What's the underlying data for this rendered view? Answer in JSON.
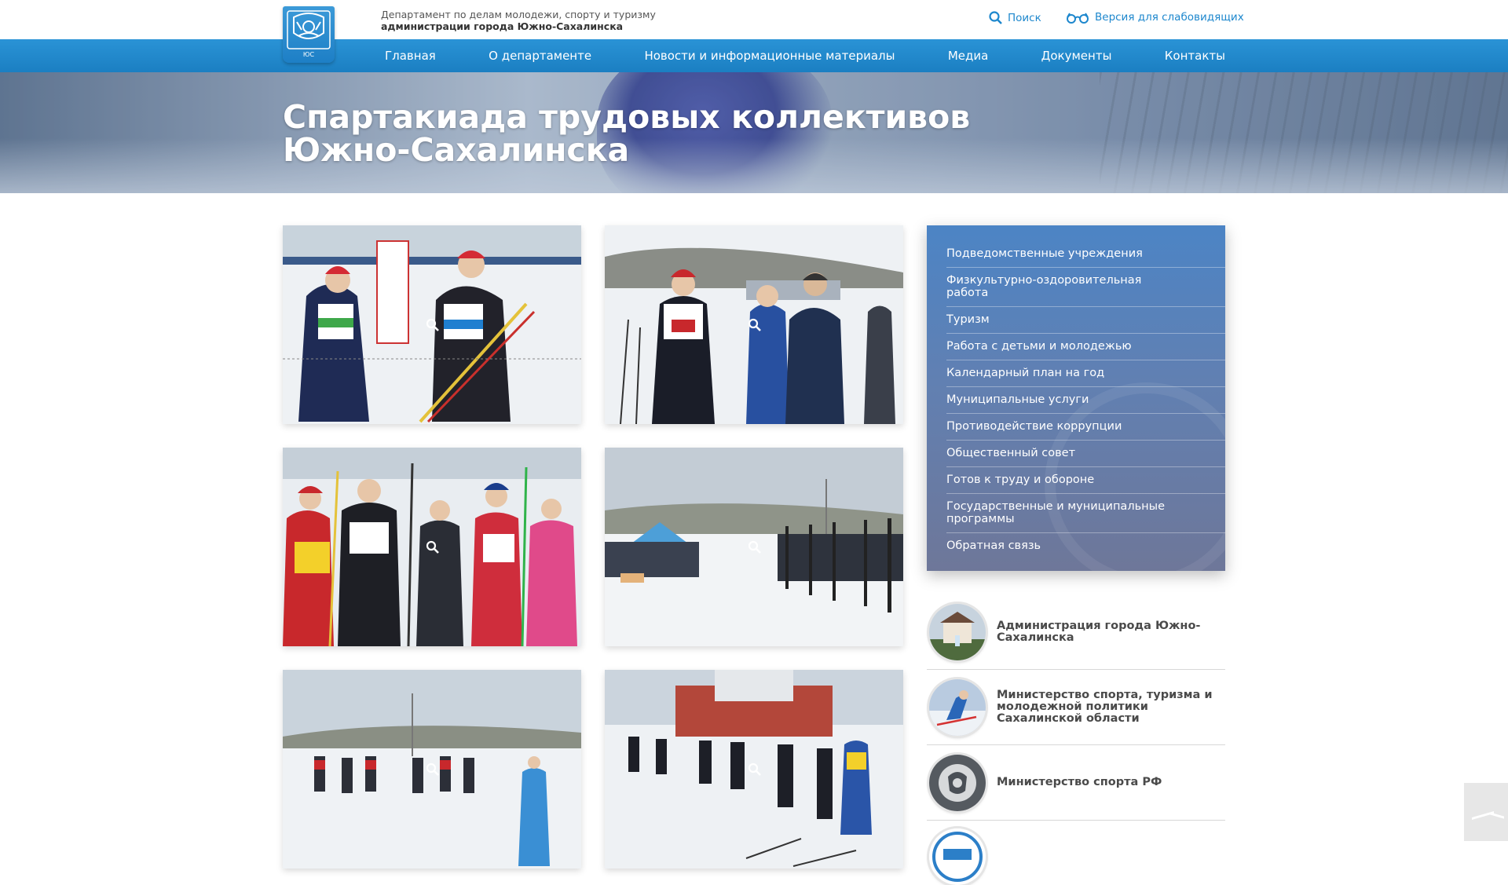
{
  "header": {
    "dept_line1": "Департамент по делам молодежи, спорту и туризму",
    "dept_line2": "администрации города Южно-Сахалинска",
    "search_label": "Поиск",
    "vision_label": "Версия для слабовидящих",
    "logo_text": "ЮС"
  },
  "nav": {
    "items": [
      "Главная",
      "О департаменте",
      "Новости и информационные материалы",
      "Медиа",
      "Документы",
      "Контакты"
    ]
  },
  "hero": {
    "title": "Спартакиада трудовых коллективов Южно-Сахалинска"
  },
  "gallery": {
    "photos": [
      {
        "scene": "two-skiers-bibs-6"
      },
      {
        "scene": "skiers-bibs-9-and-8"
      },
      {
        "scene": "crowd-bib-14"
      },
      {
        "scene": "lineup-long-view"
      },
      {
        "scene": "start-line-wide"
      },
      {
        "scene": "skiers-church-background"
      }
    ],
    "zoom_icon": "magnifier-icon"
  },
  "sidebar": {
    "menu": [
      "Подведомственные учреждения",
      "Физкультурно-оздоровительная работа",
      "Туризм",
      "Работа с детьми и молодежью",
      "Календарный план на год",
      "Муниципальные услуги",
      "Противодействие коррупции",
      "Общественный совет",
      "Готов к труду и обороне",
      "Государственные и муниципальные программы",
      "Обратная связь"
    ],
    "links": [
      {
        "label": "Администрация города Южно-Сахалинска",
        "icon": "city-hall-icon"
      },
      {
        "label": "Министерство спорта, туризма и молодежной политики Сахалинской области",
        "icon": "skier-icon"
      },
      {
        "label": "Министерство спорта РФ",
        "icon": "eagle-emblem-icon"
      },
      {
        "label": "",
        "icon": "gto-icon"
      }
    ]
  },
  "colors": {
    "brand_blue": "#1d87cd",
    "nav_blue": "#2188cd",
    "sidebar_top": "#4c84c5",
    "sidebar_bottom": "#6e7799"
  }
}
